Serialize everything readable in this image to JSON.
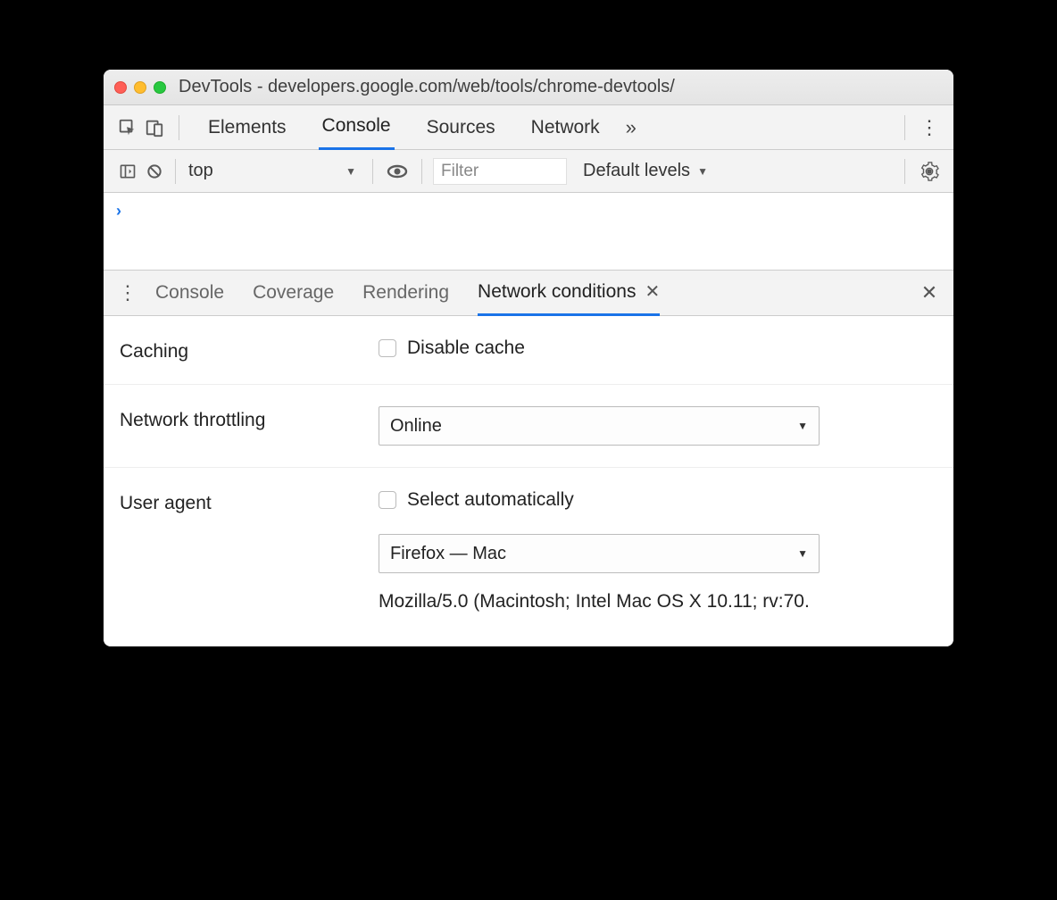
{
  "window": {
    "title": "DevTools - developers.google.com/web/tools/chrome-devtools/"
  },
  "tabs": {
    "elements": "Elements",
    "console": "Console",
    "sources": "Sources",
    "network": "Network"
  },
  "consoleToolbar": {
    "context": "top",
    "filterPlaceholder": "Filter",
    "levels": "Default levels"
  },
  "drawerTabs": {
    "console": "Console",
    "coverage": "Coverage",
    "rendering": "Rendering",
    "networkConditions": "Network conditions"
  },
  "networkConditions": {
    "cachingLabel": "Caching",
    "disableCacheLabel": "Disable cache",
    "throttlingLabel": "Network throttling",
    "throttlingValue": "Online",
    "userAgentLabel": "User agent",
    "selectAutoLabel": "Select automatically",
    "userAgentValue": "Firefox — Mac",
    "userAgentString": "Mozilla/5.0 (Macintosh; Intel Mac OS X 10.11; rv:70."
  }
}
